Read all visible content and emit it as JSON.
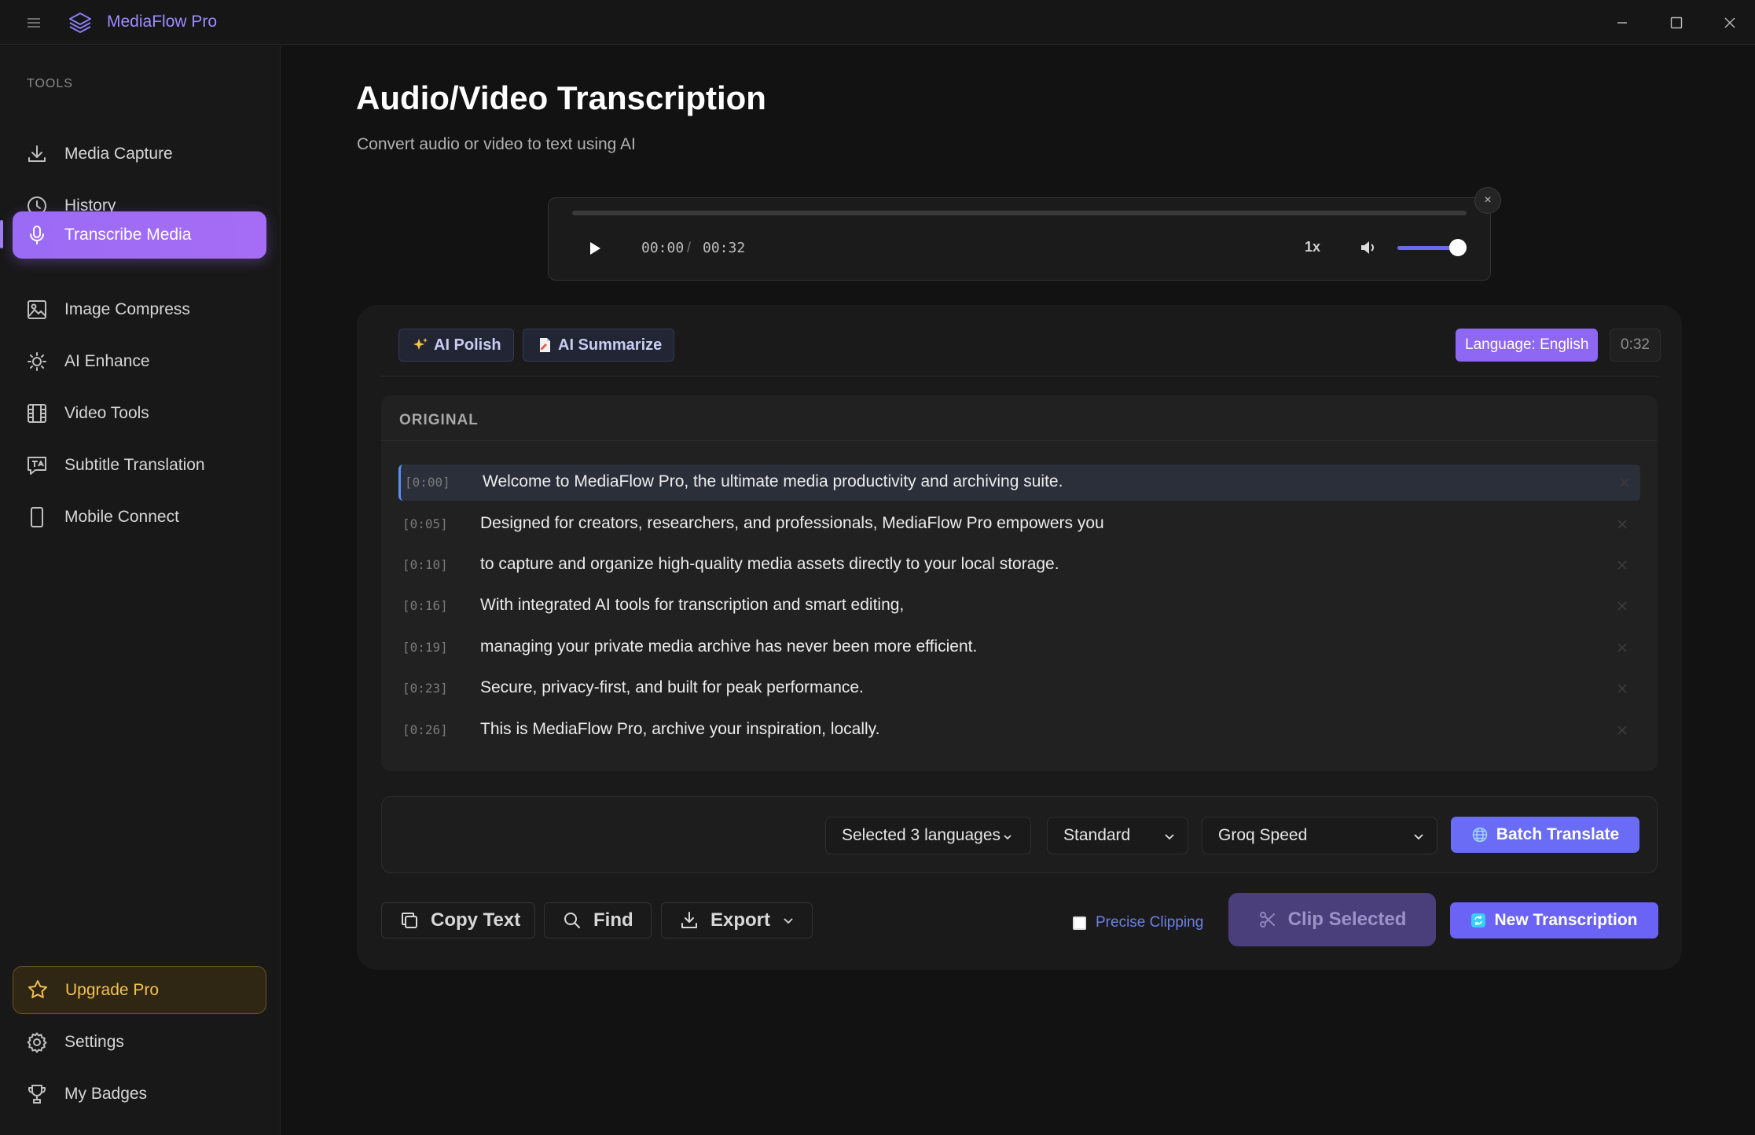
{
  "app": {
    "title": "MediaFlow Pro"
  },
  "sidebar": {
    "section_label": "TOOLS",
    "items": [
      {
        "label": "Media Capture",
        "icon": "download-icon"
      },
      {
        "label": "History",
        "icon": "clock-icon"
      },
      {
        "label": "Transcribe Media",
        "icon": "microphone-icon",
        "active": true
      },
      {
        "label": "Image Compress",
        "icon": "image-icon"
      },
      {
        "label": "AI Enhance",
        "icon": "sun-icon"
      },
      {
        "label": "Video Tools",
        "icon": "film-icon"
      },
      {
        "label": "Subtitle Translation",
        "icon": "translate-icon"
      },
      {
        "label": "Mobile Connect",
        "icon": "smartphone-icon"
      }
    ],
    "upgrade_label": "Upgrade Pro",
    "settings_label": "Settings",
    "badges_label": "My Badges"
  },
  "page": {
    "title": "Audio/Video Transcription",
    "subtitle": "Convert audio or video to text using AI"
  },
  "player": {
    "current_time": "00:00",
    "separator": "/",
    "total_time": "00:32",
    "speed": "1x",
    "progress": 0,
    "volume": 1.0,
    "close_symbol": "×"
  },
  "transcript": {
    "ai_polish_label": "AI Polish",
    "ai_summarize_label": "AI Summarize",
    "language_label": "Language: English",
    "duration": "0:32",
    "original_label": "ORIGINAL",
    "segments": [
      {
        "time": "[0:00]",
        "text": "Welcome to MediaFlow Pro, the ultimate media productivity and archiving suite.",
        "active": true
      },
      {
        "time": "[0:05]",
        "text": "Designed for creators, researchers, and professionals, MediaFlow Pro empowers you"
      },
      {
        "time": "[0:10]",
        "text": "to capture and organize high-quality media assets directly to your local storage."
      },
      {
        "time": "[0:16]",
        "text": "With integrated AI tools for transcription and smart editing,"
      },
      {
        "time": "[0:19]",
        "text": "managing your private media archive has never been more efficient."
      },
      {
        "time": "[0:23]",
        "text": "Secure, privacy-first, and built for peak performance."
      },
      {
        "time": "[0:26]",
        "text": "This is MediaFlow Pro, archive your inspiration, locally."
      }
    ]
  },
  "translate_bar": {
    "languages_select": "Selected 3 languages",
    "quality_select": "Standard",
    "engine_select": "Groq Speed",
    "batch_label": "Batch Translate"
  },
  "actions": {
    "copy_label": "Copy Text",
    "find_label": "Find",
    "export_label": "Export",
    "precise_label": "Precise Clipping",
    "precise_checked": false,
    "clip_label": "Clip Selected",
    "new_label": "New Transcription"
  },
  "colors": {
    "accent": "#9b6bf5",
    "primary_button": "#6a6cf5",
    "upgrade_gold": "#f2c14e",
    "background": "#121212"
  }
}
